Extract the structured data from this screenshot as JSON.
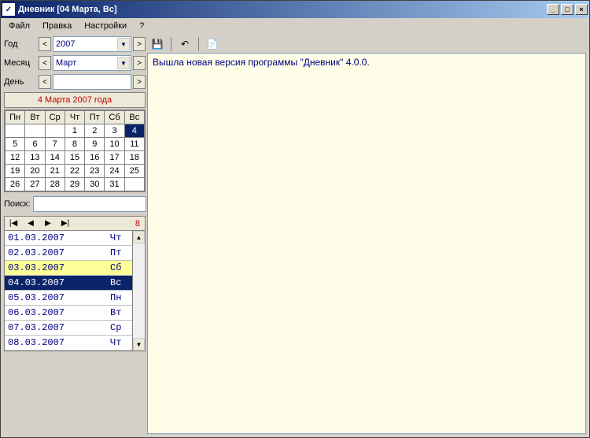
{
  "title": "Дневник  [04 Марта, Вс]",
  "menu": {
    "file": "Файл",
    "edit": "Правка",
    "settings": "Настройки",
    "help": "?"
  },
  "labels": {
    "year": "Год",
    "month": "Месяц",
    "day": "День",
    "search": "Поиск:"
  },
  "selectors": {
    "year": "2007",
    "month": "Март",
    "day": ""
  },
  "nav": {
    "prev": "<",
    "next": ">"
  },
  "calendar": {
    "caption": "4 Марта 2007 года",
    "weekdays": [
      "Пн",
      "Вт",
      "Ср",
      "Чт",
      "Пт",
      "Сб",
      "Вс"
    ],
    "selected": 4,
    "rows": [
      [
        "",
        "",
        "",
        "1",
        "2",
        "3",
        "4"
      ],
      [
        "5",
        "6",
        "7",
        "8",
        "9",
        "10",
        "11"
      ],
      [
        "12",
        "13",
        "14",
        "15",
        "16",
        "17",
        "18"
      ],
      [
        "19",
        "20",
        "21",
        "22",
        "23",
        "24",
        "25"
      ],
      [
        "26",
        "27",
        "28",
        "29",
        "30",
        "31",
        ""
      ]
    ]
  },
  "entriesNav": {
    "first": "|◀",
    "prev": "◀",
    "next": "▶",
    "last": "▶|",
    "count": "8"
  },
  "entries": [
    {
      "date": "01.03.2007",
      "wd": "Чт",
      "cls": ""
    },
    {
      "date": "02.03.2007",
      "wd": "Пт",
      "cls": ""
    },
    {
      "date": "03.03.2007",
      "wd": "Сб",
      "cls": "sat"
    },
    {
      "date": "04.03.2007",
      "wd": "Вс",
      "cls": "sel"
    },
    {
      "date": "05.03.2007",
      "wd": "Пн",
      "cls": ""
    },
    {
      "date": "06.03.2007",
      "wd": "Вт",
      "cls": ""
    },
    {
      "date": "07.03.2007",
      "wd": "Ср",
      "cls": ""
    },
    {
      "date": "08.03.2007",
      "wd": "Чт",
      "cls": ""
    }
  ],
  "toolbar": {
    "save": "💾",
    "undo": "↶",
    "new": "📄"
  },
  "editorText": "Вышла новая версия программы \"Дневник\" 4.0.0."
}
